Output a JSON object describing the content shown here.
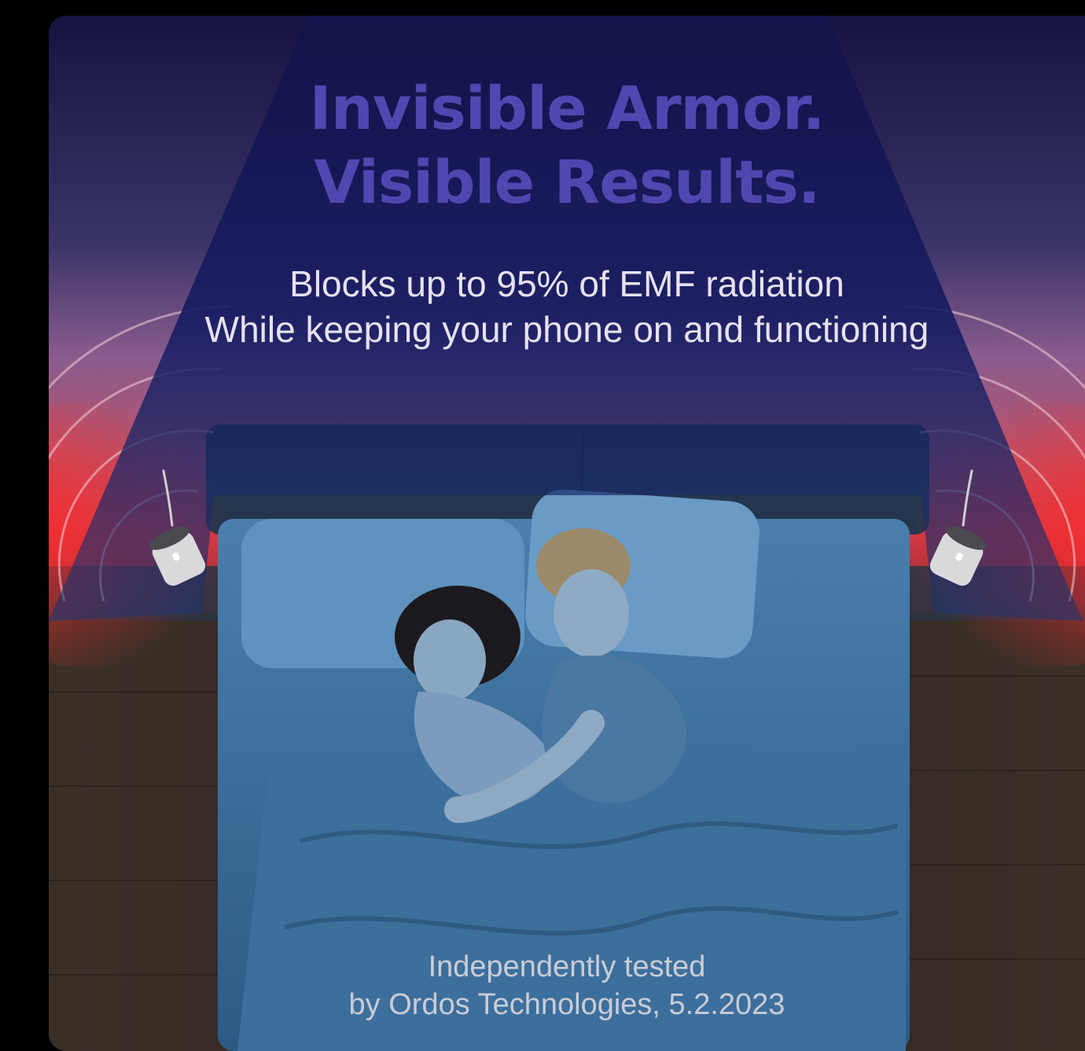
{
  "headline": {
    "line1": "Invisible Armor.",
    "line2": "Visible Results."
  },
  "subheadline": {
    "line1": "Blocks up to 95% of EMF radiation",
    "line2": "While keeping your phone on and functioning"
  },
  "footnote": {
    "line1": "Independently tested",
    "line2": "by Ordos Technologies, 5.2.2023"
  },
  "colors": {
    "headline": "#5048b0",
    "shield_beam": "#1a1f6e",
    "radiation_glow": "#e0202a",
    "bedding": "#3b6d9a",
    "floor": "#3a2e26"
  },
  "icons": [
    "emf-shield-device-left",
    "emf-shield-device-right",
    "radiation-wave-left",
    "radiation-wave-right"
  ]
}
